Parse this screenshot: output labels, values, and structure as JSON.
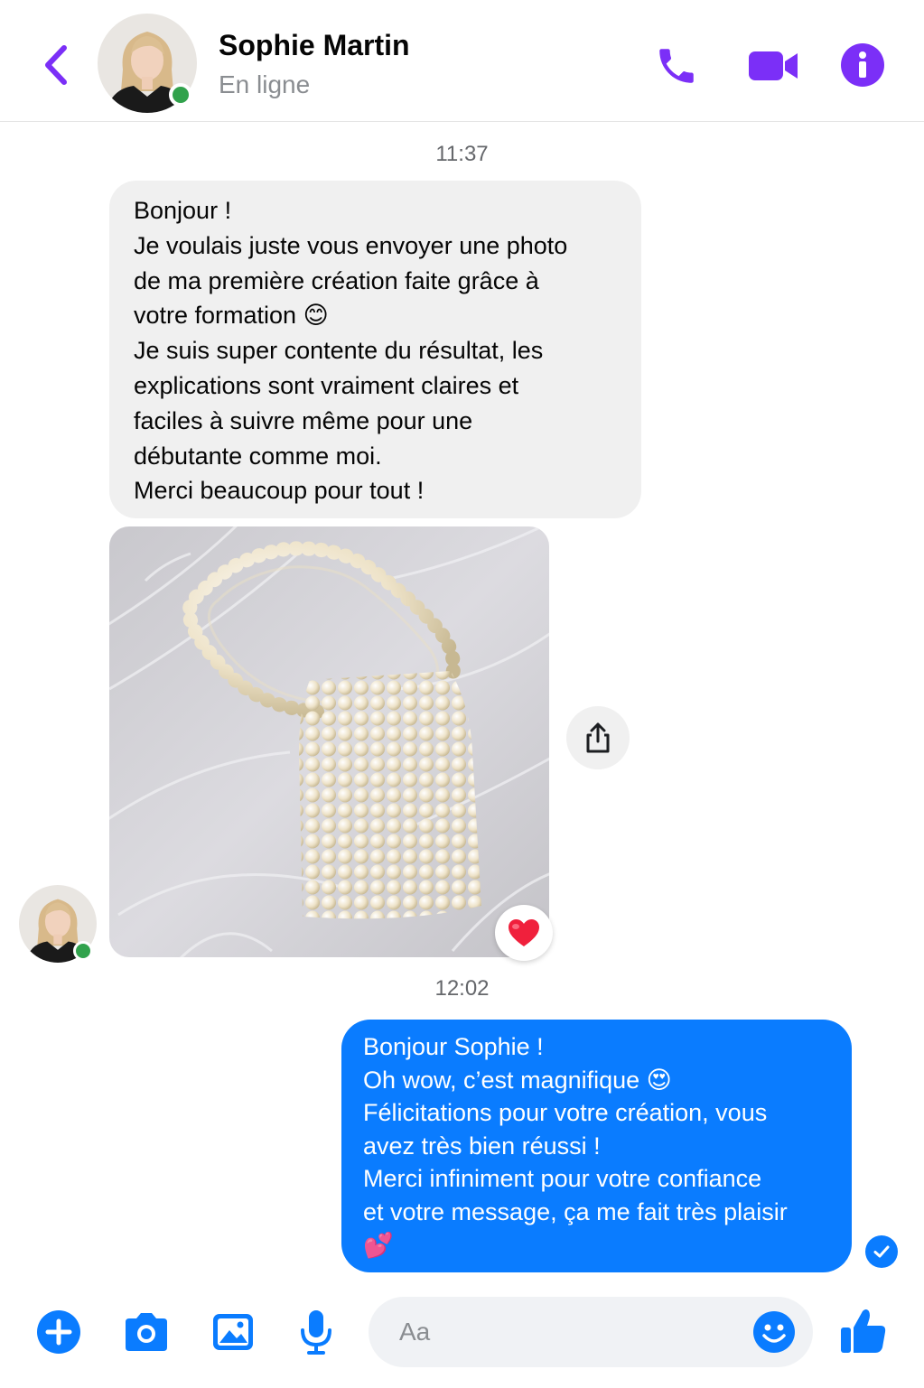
{
  "header": {
    "contact_name": "Sophie Martin",
    "status": "En ligne",
    "icons": {
      "back": "chevron-left-icon",
      "call": "phone-icon",
      "video": "video-camera-icon",
      "info": "info-icon"
    }
  },
  "messages": [
    {
      "timestamp": "11:37",
      "sender": "Sophie Martin",
      "direction": "incoming",
      "text": "Bonjour !\nJe voulais juste vous envoyer une photo\nde ma première création faite grâce à\nvotre formation 😊\nJe suis super contente du résultat, les\nexplications sont vraiment claires et\nfaciles à suivre même pour une\ndébutante comme moi.\nMerci beaucoup pour tout !",
      "attachment": {
        "type": "photo",
        "reaction": "❤️"
      }
    },
    {
      "timestamp": "12:02",
      "direction": "outgoing",
      "text": "Bonjour Sophie !\nOh wow, c’est magnifique 😍\nFélicitations pour votre création, vous\navez très bien réussi !\nMerci infiniment pour votre confiance\net votre message, ça me fait très plaisir\n💕",
      "status": "read"
    }
  ],
  "composer": {
    "placeholder": "Aa",
    "icons": [
      "plus-icon",
      "camera-icon",
      "image-icon",
      "microphone-icon",
      "emoji-icon",
      "thumbs-up-icon"
    ]
  },
  "colors": {
    "accent": "#7b2ff7",
    "outgoing_bubble": "#0a7cff",
    "incoming_bubble": "#f0f0f0",
    "online": "#31a24c"
  }
}
